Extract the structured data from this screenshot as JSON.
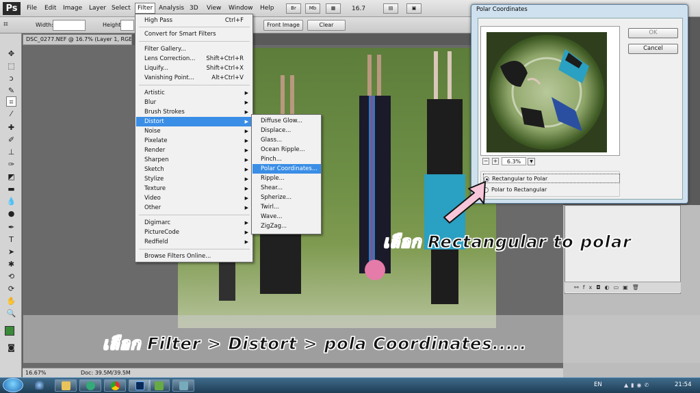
{
  "app": {
    "logo": "Ps"
  },
  "menubar": {
    "items": [
      "File",
      "Edit",
      "Image",
      "Layer",
      "Select",
      "Filter",
      "Analysis",
      "3D",
      "View",
      "Window",
      "Help"
    ],
    "tools": [
      "Br",
      "Mb"
    ],
    "zoom": "16.7"
  },
  "options": {
    "width_label": "Width:",
    "height_label": "Height:",
    "front_image": "Front Image",
    "clear": "Clear"
  },
  "document": {
    "tab": "DSC_0277.NEF @ 16.7% (Layer 1, RGB/8)",
    "status_zoom": "16.67%",
    "status_doc": "Doc: 39.5M/39.5M"
  },
  "filter_menu": {
    "high_pass": "High Pass",
    "high_pass_sc": "Ctrl+F",
    "convert_smart": "Convert for Smart Filters",
    "gallery": "Filter Gallery...",
    "lens": "Lens Correction...",
    "lens_sc": "Shift+Ctrl+R",
    "liquify": "Liquify...",
    "liquify_sc": "Shift+Ctrl+X",
    "vanishing": "Vanishing Point...",
    "vanishing_sc": "Alt+Ctrl+V",
    "artistic": "Artistic",
    "blur": "Blur",
    "brush": "Brush Strokes",
    "distort": "Distort",
    "noise": "Noise",
    "pixelate": "Pixelate",
    "render": "Render",
    "sharpen": "Sharpen",
    "sketch": "Sketch",
    "stylize": "Stylize",
    "texture": "Texture",
    "video": "Video",
    "other": "Other",
    "digimarc": "Digimarc",
    "picturecode": "PictureCode",
    "redfield": "Redfield",
    "browse": "Browse Filters Online..."
  },
  "distort_menu": [
    "Diffuse Glow...",
    "Displace...",
    "Glass...",
    "Ocean Ripple...",
    "Pinch...",
    "Polar Coordinates...",
    "Ripple...",
    "Shear...",
    "Spherize...",
    "Twirl...",
    "Wave...",
    "ZigZag..."
  ],
  "dialog": {
    "title": "Polar Coordinates",
    "ok": "OK",
    "cancel": "Cancel",
    "zoom": "6.3%",
    "zoom_minus": "−",
    "zoom_plus": "+",
    "option1": "Rectangular to Polar",
    "option2": "Polar to Rectangular",
    "selected": "Rectangular to Polar"
  },
  "captions": {
    "right": "เลือก Rectangular to polar",
    "bottom": "เลือก Filter > Distort > pola Coordinates....."
  },
  "taskbar": {
    "lang": "EN",
    "time": "21:54"
  },
  "colors": {
    "menu_highlight": "#3a8ee6",
    "arrow": "#f7c6d8",
    "foreground_swatch": "#3a8a3a"
  }
}
